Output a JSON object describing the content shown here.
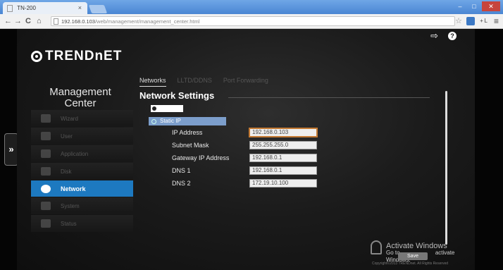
{
  "browser": {
    "tab_title": "TN-200",
    "tab_close": "×",
    "url_host": "192.168.0.103",
    "url_path": "/web/management/management_center.html",
    "nav": {
      "back": "←",
      "forward": "→",
      "reload": "C",
      "home": "⌂"
    },
    "window_buttons": {
      "minimize": "–",
      "maximize": "□",
      "close": "✕"
    },
    "star": "☆",
    "menu": "≡",
    "ext_text": "+ L"
  },
  "app": {
    "logo_text": "TRENDnET",
    "title_line1": "Management",
    "title_line2": "Center",
    "side_toggle": "»",
    "icons": {
      "logout": "logout-icon",
      "help": "help-icon"
    }
  },
  "sidebar": {
    "items": [
      {
        "label": "Wizard",
        "icon": "wizard-icon",
        "active": false
      },
      {
        "label": "User",
        "icon": "user-icon",
        "active": false
      },
      {
        "label": "Application",
        "icon": "application-icon",
        "active": false
      },
      {
        "label": "Disk",
        "icon": "disk-icon",
        "active": false
      },
      {
        "label": "Network",
        "icon": "network-icon",
        "active": true
      },
      {
        "label": "System",
        "icon": "system-icon",
        "active": false
      },
      {
        "label": "Status",
        "icon": "status-icon",
        "active": false
      }
    ]
  },
  "tabs": [
    {
      "label": "Networks",
      "active": true
    },
    {
      "label": "LLTD/DDNS",
      "active": false
    },
    {
      "label": "Port Forwarding",
      "active": false
    }
  ],
  "main": {
    "section_title": "Network Settings",
    "static_ip_label": "Static IP",
    "fields": [
      {
        "label": "IP Address",
        "value": "192.168.0.103"
      },
      {
        "label": "Subnet Mask",
        "value": "255.255.255.0"
      },
      {
        "label": "Gateway IP Address",
        "value": "192.168.0.1"
      },
      {
        "label": "DNS 1",
        "value": "192.168.0.1"
      },
      {
        "label": "DNS 2",
        "value": "172.19.10.100"
      }
    ],
    "save_label": "Save"
  },
  "watermark": {
    "title": "Activate Windows",
    "line2": "Go to",
    "line2_end": "activate Windows.",
    "copyright": "Copyright©2013 TRENDnet. All Rights Reserved"
  },
  "colors": {
    "accent": "#1d79c0",
    "static_ip_bg": "#7c9ecb",
    "focus": "#c47a33"
  }
}
